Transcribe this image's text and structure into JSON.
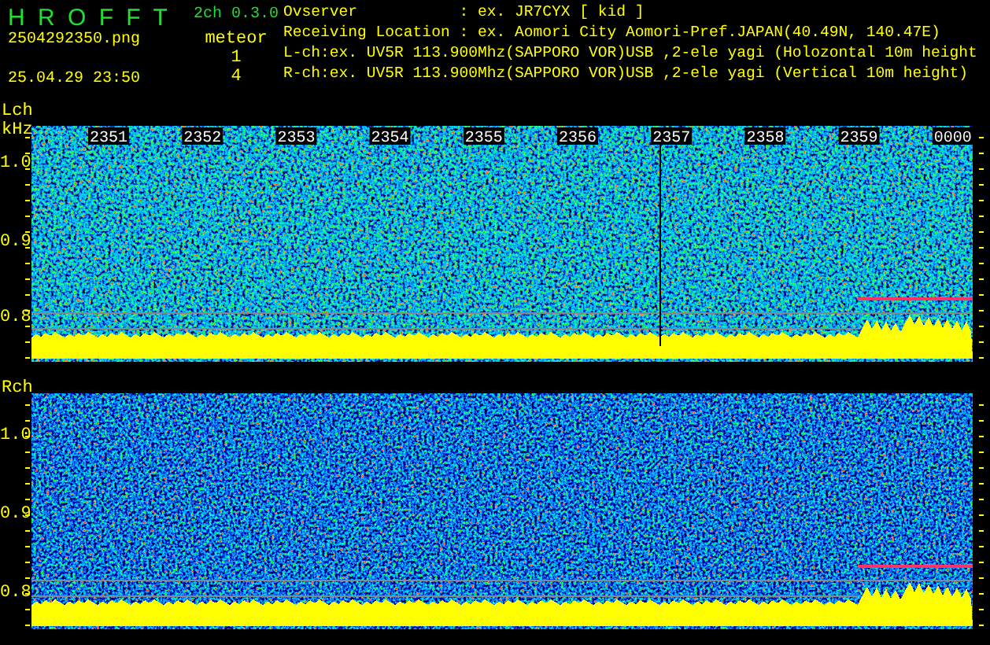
{
  "header": {
    "app_title": "H R O F F T",
    "version": "2ch 0.3.0",
    "filename": "2504292350.png",
    "datetime": "25.04.29 23:50",
    "meteor_label": "meteor",
    "meteor_counts": [
      "1",
      "4"
    ],
    "info_lines": [
      "Ovserver           : ex. JR7CYX [ kid ]",
      "Receiving Location : ex. Aomori City Aomori-Pref.JAPAN(40.49N, 140.47E)",
      "L-ch:ex. UV5R 113.900Mhz(SAPPORO VOR)USB ,2-ele yagi (Holozontal 10m height",
      "R-ch:ex. UV5R 113.900Mhz(SAPPORO VOR)USB ,2-ele yagi (Vertical 10m height)"
    ]
  },
  "channels": [
    {
      "label": "Lch",
      "unit": "kHz",
      "time_labels": [
        "2351",
        "2352",
        "2353",
        "2354",
        "2355",
        "2356",
        "2357",
        "2358",
        "2359",
        "0000"
      ],
      "y_labels": [
        "1.0",
        "0.9",
        "0.8"
      ]
    },
    {
      "label": "Rch",
      "y_labels": [
        "1.0",
        "0.9",
        "0.8"
      ]
    }
  ]
}
